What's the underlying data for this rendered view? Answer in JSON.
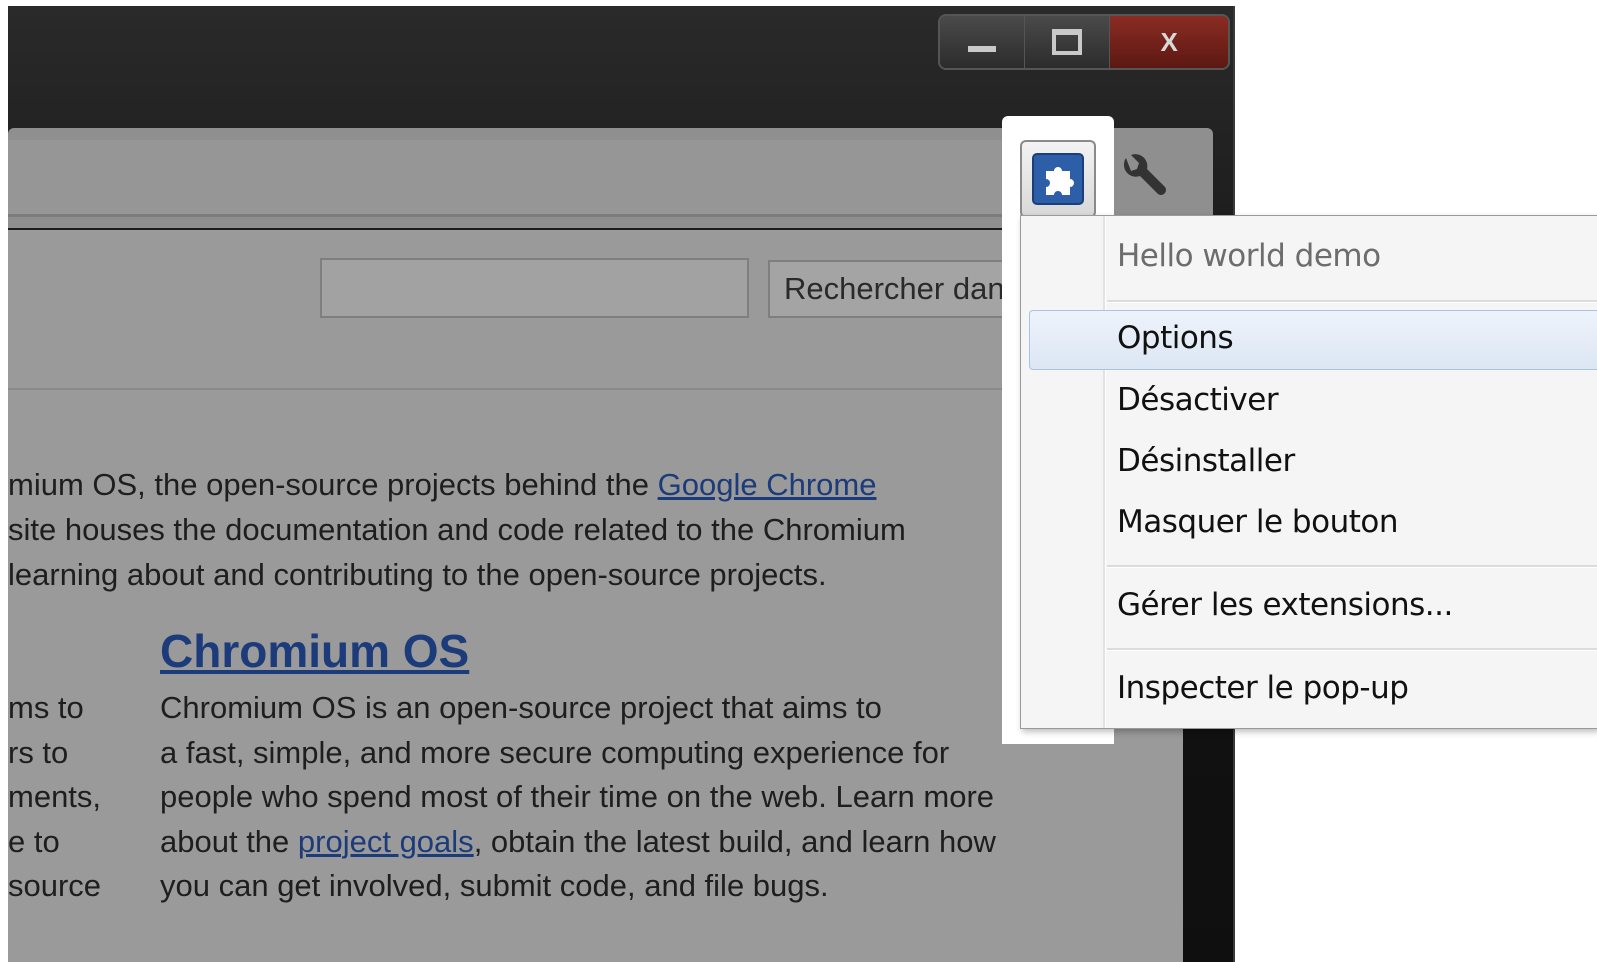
{
  "window": {
    "controls": {
      "minimize": "minimize",
      "maximize": "maximize",
      "close": "X"
    }
  },
  "toolbar": {
    "extension_icon": "puzzle-piece-icon",
    "wrench_icon": "wrench-icon"
  },
  "page": {
    "search_input_value": "",
    "search_button_label": "Rechercher dans ce site",
    "intro_lines": [
      {
        "before": "mium OS, the open-source projects behind the ",
        "link": "Google Chrome"
      },
      {
        "text": "site houses the documentation and code related to the Chromium"
      },
      {
        "text": "learning about and contributing to the open-source projects."
      }
    ],
    "left_column": [
      "ms to",
      "rs to",
      "ments,",
      "e to",
      "source"
    ],
    "section_heading": "Chromium OS",
    "section_lines": [
      "Chromium OS is an open-source project that aims to",
      "a fast, simple, and more secure computing experience for",
      "people who spend most of their time on the web.  Learn more"
    ],
    "section_line4": {
      "before": "about the ",
      "link": "project goals",
      "after": ", obtain the latest build, and learn how"
    },
    "section_line5": "you can get involved, submit code, and file bugs."
  },
  "context_menu": {
    "title": "Hello world demo",
    "items": [
      "Options",
      "Désactiver",
      "Désinstaller",
      "Masquer le bouton"
    ],
    "manage": "Gérer les extensions...",
    "inspect": "Inspecter le pop-up",
    "hovered_item": "Options"
  },
  "colors": {
    "link": "#1c3b7a",
    "menu_hover": "#dce6f4",
    "close_button": "#8a2c23"
  }
}
